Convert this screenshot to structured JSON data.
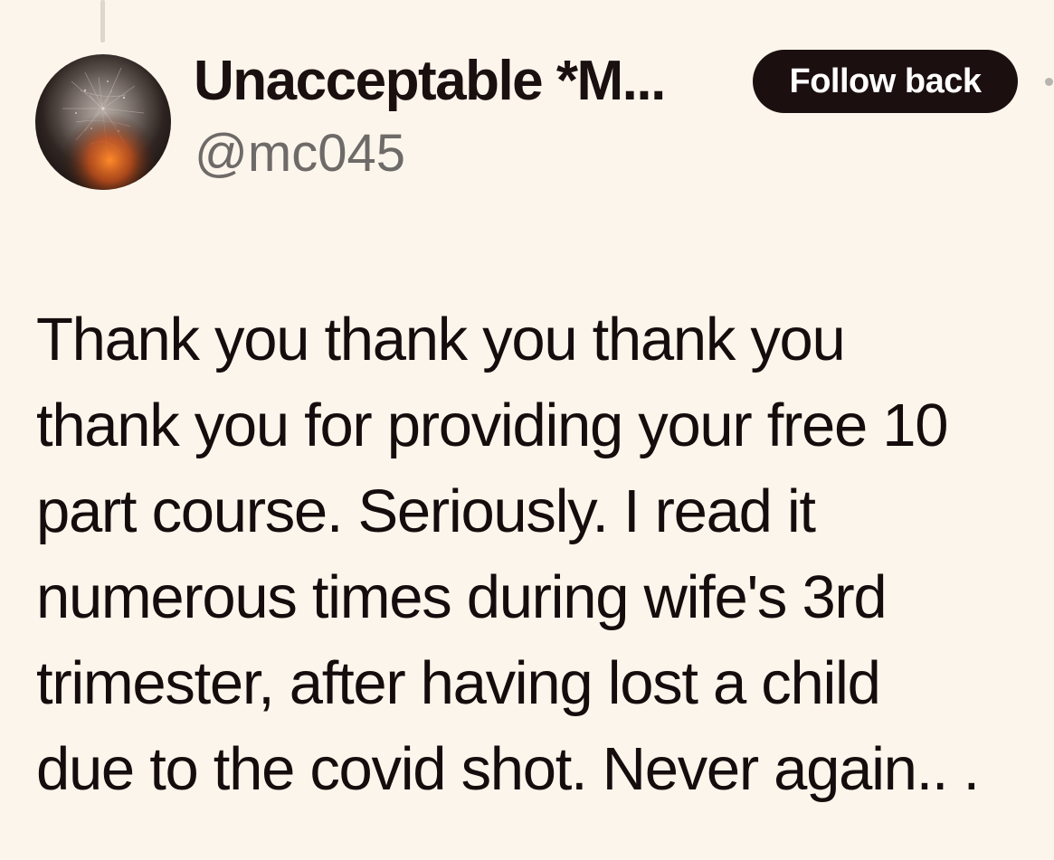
{
  "post": {
    "author": {
      "display_name": "Unacceptable *M...",
      "handle": "@mc045",
      "avatar_icon": "avatar-image"
    },
    "follow_button_label": "Follow back",
    "body_text": "Thank you thank you thank you\nthank you for providing your free 10\npart course. Seriously. I read it\nnumerous times during wife's 3rd\ntrimester, after having lost a child\ndue to the covid shot. Never again.. ."
  },
  "colors": {
    "background": "#fcf5eb",
    "text": "#1a1010",
    "handle_text": "#6d6a68",
    "button_bg": "#1c0f0f",
    "button_text": "#ffffff"
  }
}
